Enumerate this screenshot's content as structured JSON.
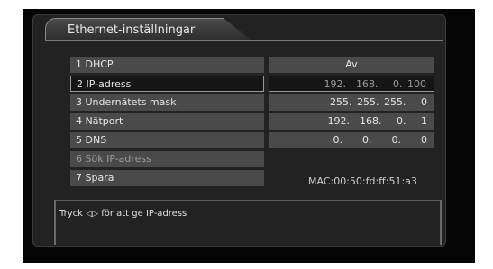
{
  "header": {
    "title": "Ethernet-inställningar"
  },
  "settings": [
    {
      "label": "1 DHCP",
      "value": "Av",
      "center": true
    },
    {
      "label": "2 IP-adress",
      "value": "192.  168.   0. 100",
      "selected": true
    },
    {
      "label": "3 Undernätets mask",
      "value": "255. 255. 255.   0"
    },
    {
      "label": "4 Nätport",
      "value": "192.  168.   0.   1"
    },
    {
      "label": "5 DNS",
      "value": "0.    0.    0.    0"
    },
    {
      "label": "6 Sök IP-adress",
      "value": "",
      "dim": true
    },
    {
      "label": "7 Spara",
      "value": ""
    }
  ],
  "mac": "MAC:00:50:fd:ff:51:a3",
  "footer": {
    "hint_prefix": "Tryck",
    "hint_icon": "◁▷",
    "hint_suffix": "för att ge IP-adress"
  }
}
